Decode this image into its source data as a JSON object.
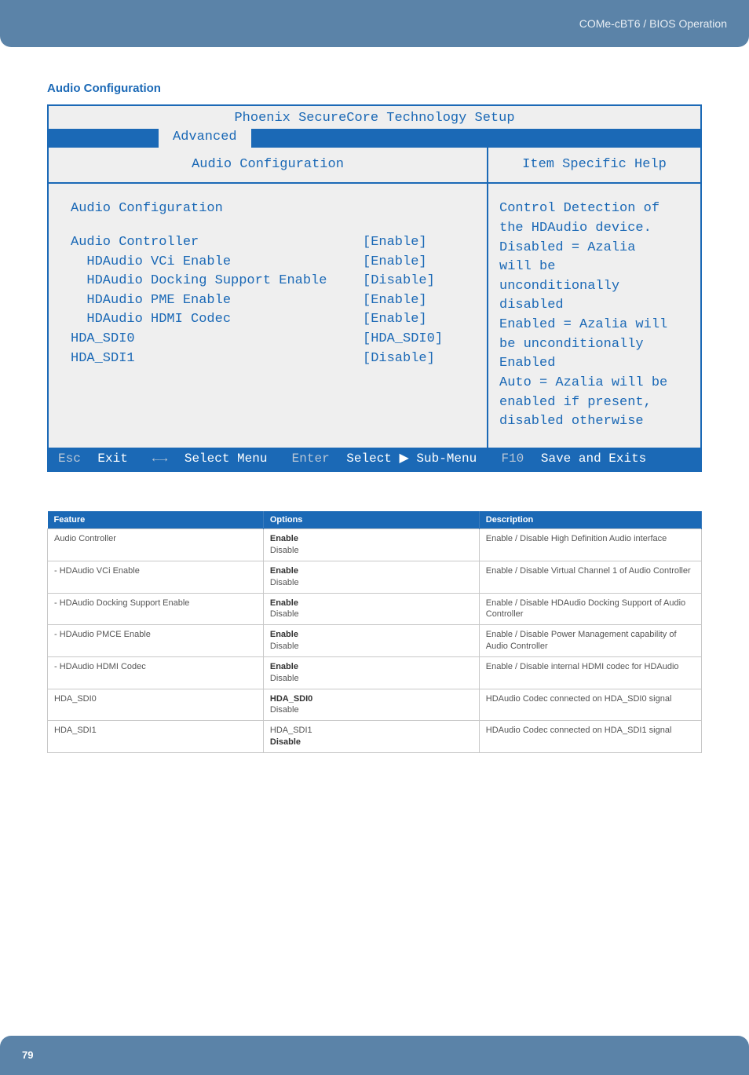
{
  "header": {
    "breadcrumb": "COMe-cBT6 / BIOS Operation"
  },
  "section": {
    "title": "Audio Configuration"
  },
  "bios": {
    "title": "Phoenix SecureCore Technology Setup",
    "active_tab": "Advanced",
    "panel_title": "Audio Configuration",
    "help_title": "Item Specific Help",
    "heading": "Audio Configuration",
    "items": [
      {
        "label": "Audio Controller",
        "value": "[Enable]"
      },
      {
        "label": "  HDAudio VCi Enable",
        "value": "[Enable]"
      },
      {
        "label": "  HDAudio Docking Support Enable",
        "value": "[Disable]"
      },
      {
        "label": "  HDAudio PME Enable",
        "value": "[Enable]"
      },
      {
        "label": "  HDAudio HDMI Codec",
        "value": "[Enable]"
      },
      {
        "label": "HDA_SDI0",
        "value": "[HDA_SDI0]"
      },
      {
        "label": "HDA_SDI1",
        "value": "[Disable]"
      }
    ],
    "help_lines": [
      "Control Detection of",
      "the HDAudio device.",
      "",
      "Disabled = Azalia",
      "will be",
      "unconditionally",
      "disabled",
      "",
      "Enabled = Azalia will",
      "be unconditionally",
      "Enabled",
      "",
      "Auto = Azalia will be",
      "enabled if present,",
      "disabled otherwise"
    ],
    "footer": {
      "esc": "Esc",
      "exit": "Exit",
      "arrows": "←→",
      "select_menu": "Select Menu",
      "enter": "Enter",
      "select_sub": "Select ▶ Sub-Menu",
      "f10": "F10",
      "save": "Save and Exits"
    }
  },
  "table": {
    "headers": {
      "feature": "Feature",
      "options": "Options",
      "description": "Description"
    },
    "rows": [
      {
        "feature": "Audio Controller",
        "opt_bold": "Enable",
        "opt_plain": "Disable",
        "desc": "Enable / Disable High Definition Audio interface"
      },
      {
        "feature": "- HDAudio VCi Enable",
        "opt_bold": "Enable",
        "opt_plain": "Disable",
        "desc": "Enable / Disable Virtual Channel 1 of Audio Controller"
      },
      {
        "feature": "- HDAudio Docking Support Enable",
        "opt_bold": "Enable",
        "opt_plain": "Disable",
        "desc": "Enable / Disable HDAudio Docking Support of Audio Controller"
      },
      {
        "feature": "- HDAudio PMCE Enable",
        "opt_bold": "Enable",
        "opt_plain": "Disable",
        "desc": "Enable / Disable Power Management capability of Audio Controller"
      },
      {
        "feature": "- HDAudio HDMI Codec",
        "opt_bold": "Enable",
        "opt_plain": "Disable",
        "desc": "Enable / Disable internal HDMI codec for HDAudio"
      },
      {
        "feature": "HDA_SDI0",
        "opt_bold": "HDA_SDI0",
        "opt_plain": "Disable",
        "desc": "HDAudio Codec connected on HDA_SDI0 signal"
      },
      {
        "feature": "HDA_SDI1",
        "opt_plain_first": "HDA_SDI1",
        "opt_bold": "Disable",
        "desc": "HDAudio Codec connected on HDA_SDI1 signal"
      }
    ]
  },
  "page_number": "79"
}
